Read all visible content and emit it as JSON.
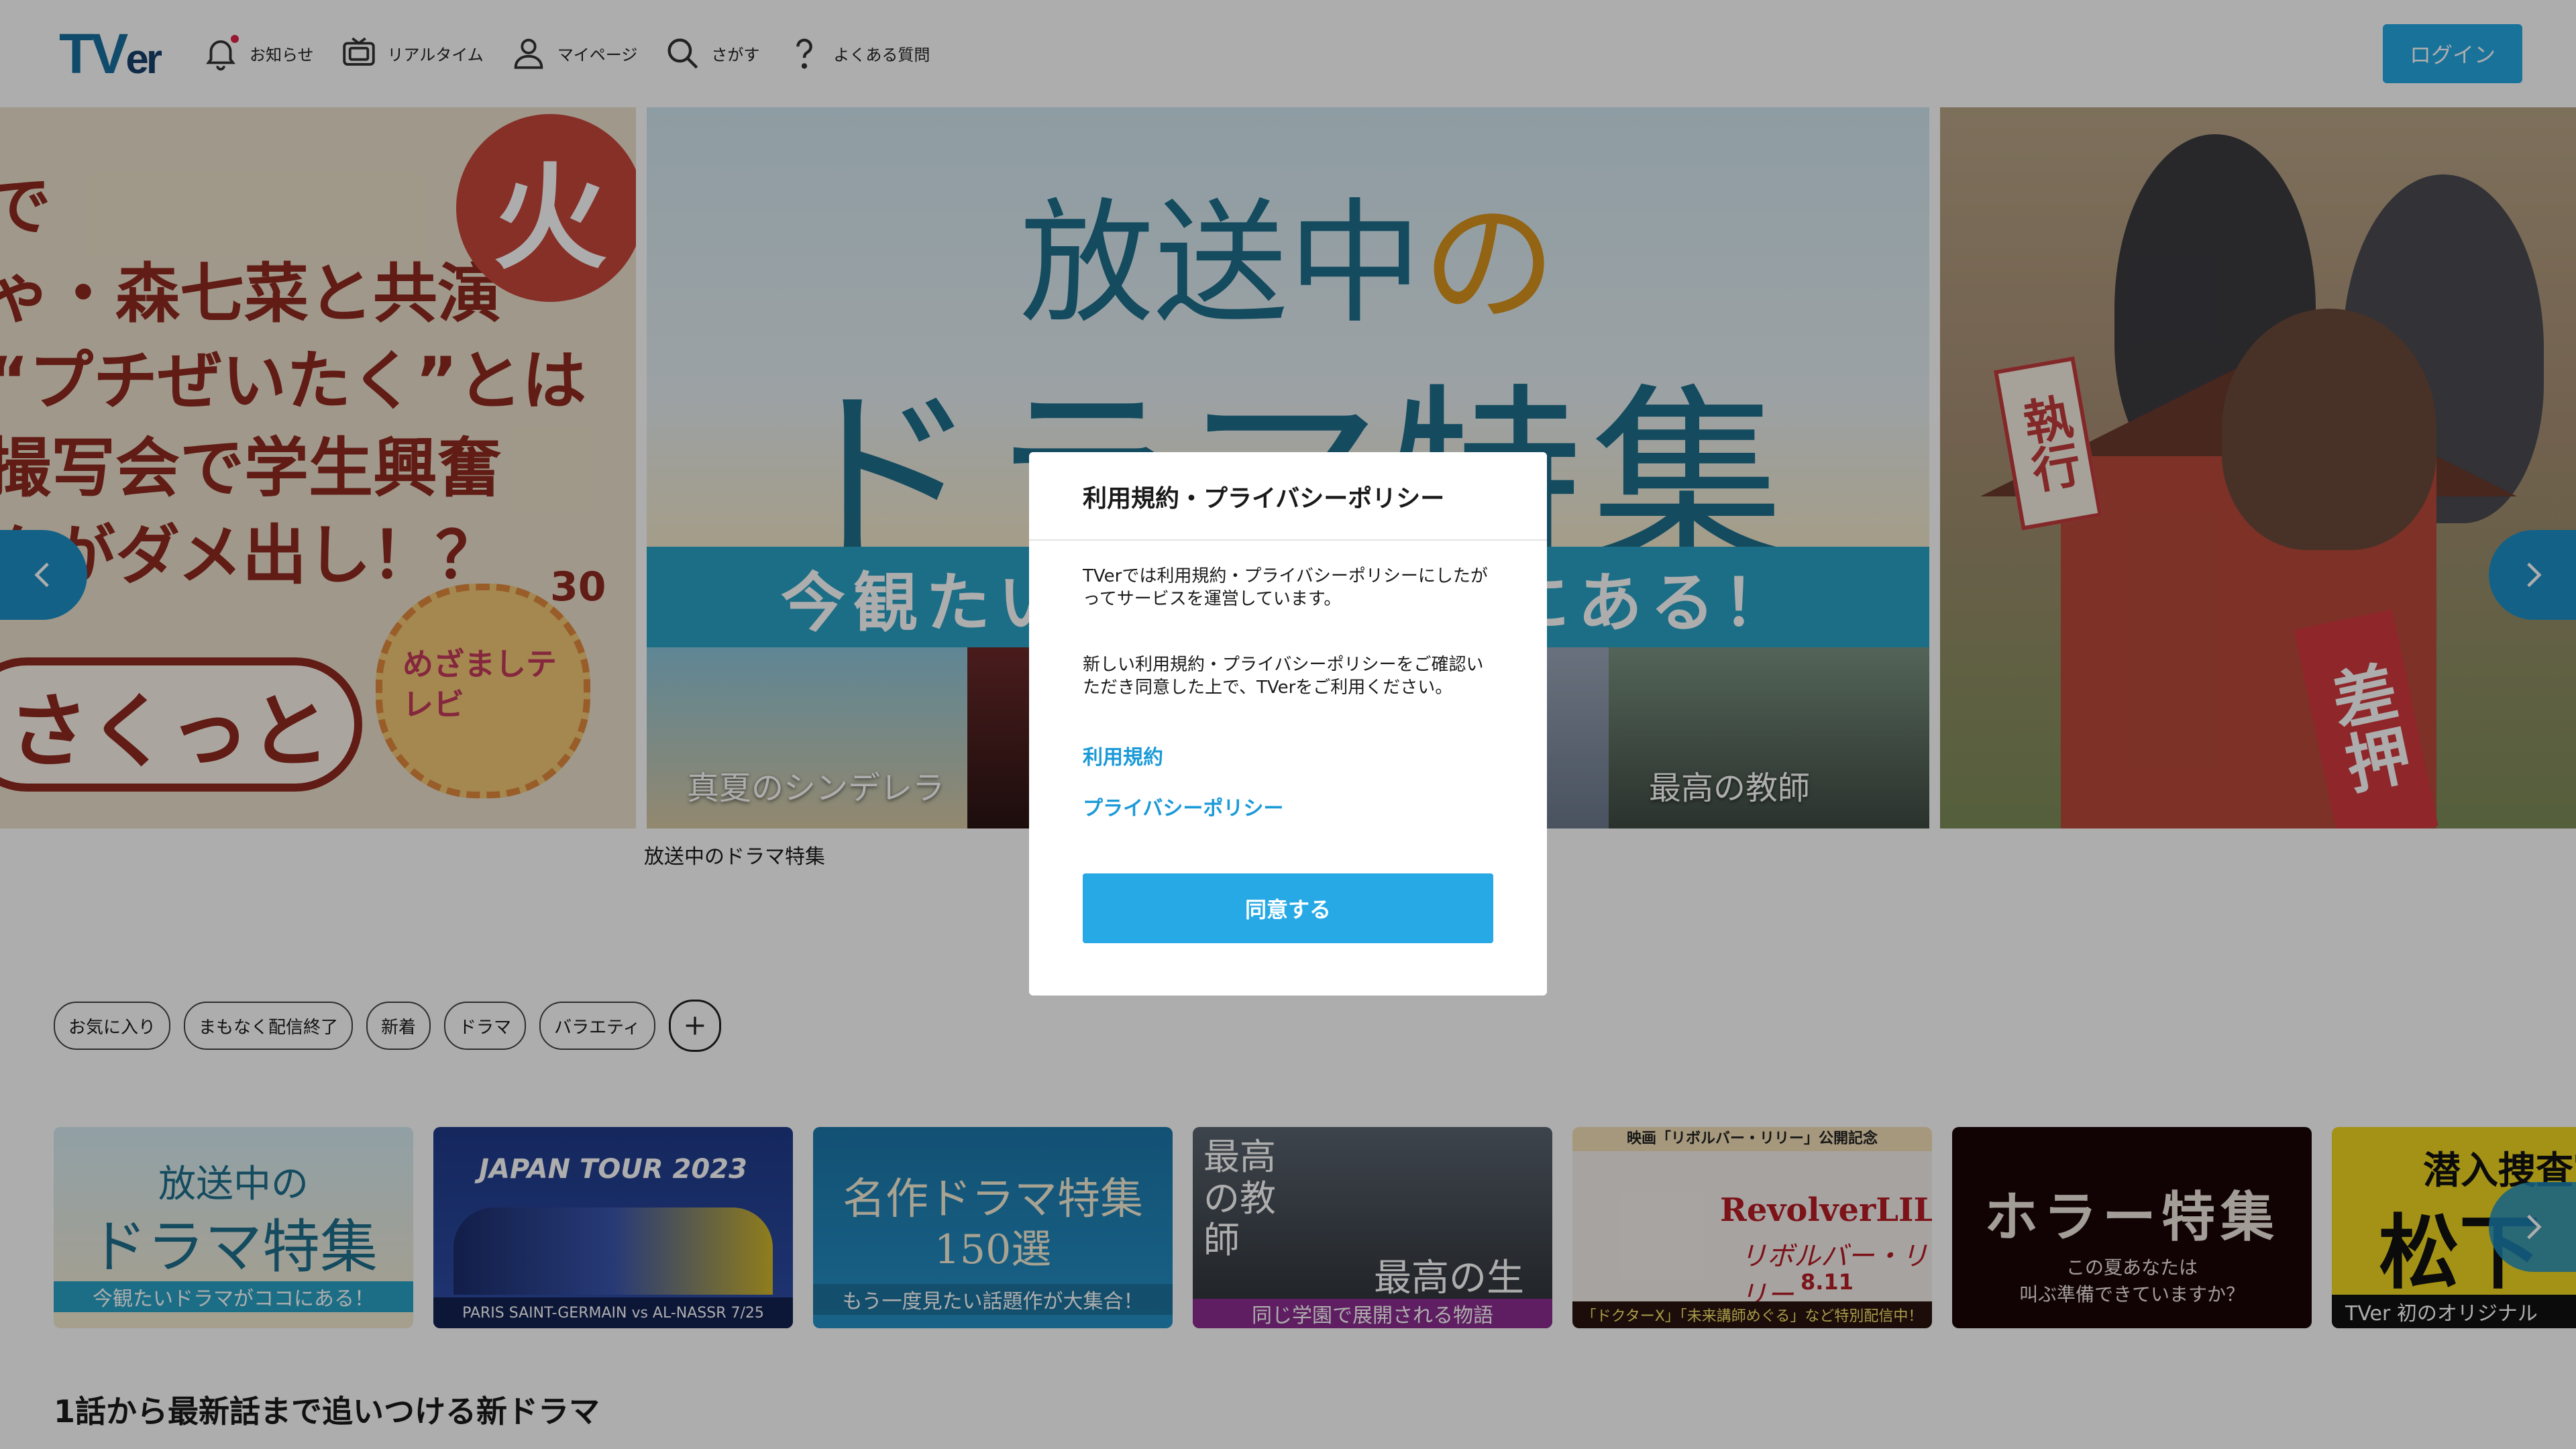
{
  "header": {
    "logo_main": "TV",
    "logo_small": "er",
    "nav": [
      {
        "label": "お知らせ"
      },
      {
        "label": "リアルタイム"
      },
      {
        "label": "マイページ"
      },
      {
        "label": "さがす"
      },
      {
        "label": "よくある質問"
      }
    ],
    "login_label": "ログイン"
  },
  "hero": {
    "left_slide": {
      "lines": [
        "で",
        "ゃ・森七菜と共演",
        "“プチぜいたく”とは",
        "撮写会で学生興奮",
        "クがダメ出し！？"
      ],
      "badge": "火",
      "bubble": "さくっと",
      "sun_text": "めざましテレビ",
      "sun_number": "30"
    },
    "center_slide": {
      "title_line1_main": "放送中",
      "title_line1_accent": "の",
      "title_line2": "ドラマ特集",
      "band_text": "今観たいドラマがココにある！",
      "thumbs": [
        {
          "caption": "真夏のシンデレラ"
        },
        {
          "caption": ""
        },
        {
          "caption": ""
        },
        {
          "caption": "最高の教師"
        }
      ]
    },
    "right_slide": {
      "sign_text": "差押",
      "stamp_text": "執行"
    },
    "caption": "放送中のドラマ特集"
  },
  "chips": [
    "お気に入り",
    "まもなく配信終了",
    "新着",
    "ドラマ",
    "バラエティ"
  ],
  "features": [
    {
      "line1": "放送中の",
      "line2": "ドラマ特集",
      "band": "今観たいドラマがココにある！"
    },
    {
      "top": "JAPAN TOUR 2023",
      "bottom": "PARIS SAINT-GERMAIN vs AL-NASSR 7/25"
    },
    {
      "line1": "名作ドラマ特集",
      "line2": "150選",
      "band": "もう一度見たい話題作が大集合！"
    },
    {
      "line1": "最高の教師",
      "line2": "最高の生徒",
      "band": "同じ学園で展開される物語"
    },
    {
      "top": "映画「リボルバー・リリー」公開記念",
      "line1": "RevolverLILY",
      "line2": "リボルバー・リリー",
      "date": "8.11",
      "band": "「ドクターX」「未来講師めぐる」など特別配信中！"
    },
    {
      "line1": "ホラー特集",
      "line2": "この夏あなたは",
      "line3": "叫ぶ準備できていますか？"
    },
    {
      "line1": "潜入捜査官",
      "line2": "松下",
      "band": "TVer 初のオリジナル"
    }
  ],
  "section_title": "1話から最新話まで追いつける新ドラマ",
  "modal": {
    "title": "利用規約・プライバシーポリシー",
    "paragraph1": "TVerでは利用規約・プライバシーポリシーにしたがってサービスを運営しています。",
    "paragraph2": "新しい利用規約・プライバシーポリシーをご確認いただき同意した上で、TVerをご利用ください。",
    "link_terms": "利用規約",
    "link_privacy": "プライバシーポリシー",
    "agree_label": "同意する"
  },
  "colors": {
    "accent": "#26a9e4",
    "link": "#1b9ad8",
    "overlay": "rgba(0,0,0,0.32)"
  }
}
